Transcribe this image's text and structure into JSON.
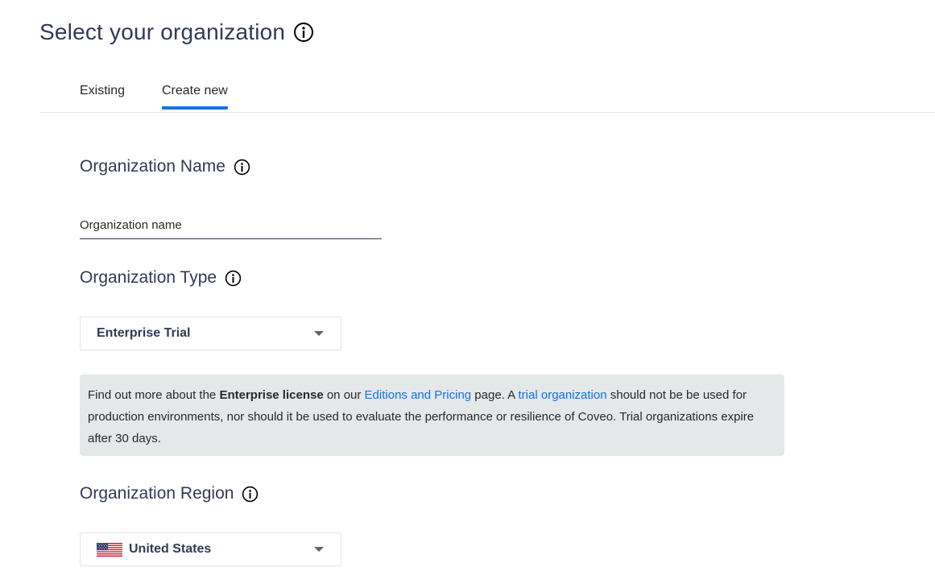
{
  "page": {
    "title": "Select your organization"
  },
  "tabs": [
    {
      "label": "Existing",
      "active": false
    },
    {
      "label": "Create new",
      "active": true
    }
  ],
  "org_name": {
    "heading": "Organization Name",
    "placeholder": "Organization name",
    "value": ""
  },
  "org_type": {
    "heading": "Organization Type",
    "selected": "Enterprise Trial"
  },
  "info_box": {
    "part1": "Find out more about the ",
    "bold": "Enterprise license",
    "part2": " on our ",
    "link1": "Editions and Pricing",
    "part3": " page. A ",
    "link2": "trial organization",
    "part4": " should not be be used for production environments, nor should it be used to evaluate the performance or resilience of Coveo. Trial organizations expire after 30 days."
  },
  "org_region": {
    "heading": "Organization Region",
    "selected": "United States",
    "flag": "us-flag-icon"
  },
  "colors": {
    "accent": "#1372ec",
    "heading": "#313a56",
    "info_bg": "#e5e8e8"
  }
}
